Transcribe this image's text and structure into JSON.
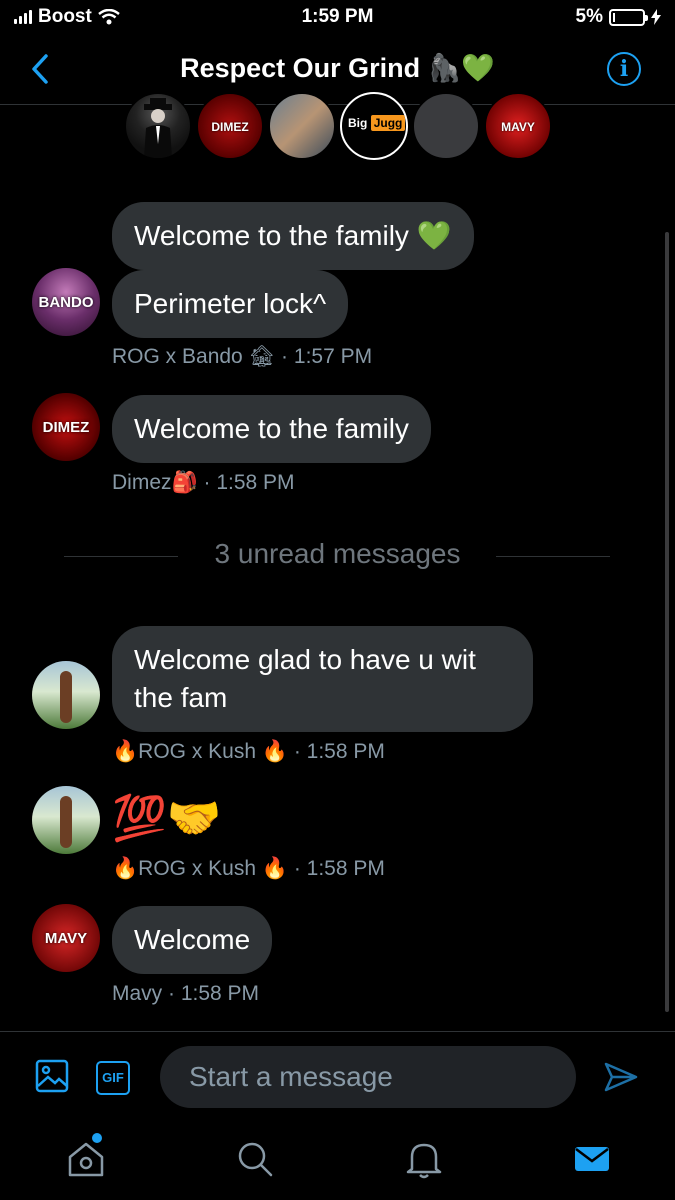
{
  "status_bar": {
    "carrier": "Boost",
    "time": "1:59 PM",
    "battery": "5%"
  },
  "header": {
    "title": "Respect Our Grind 🦍💚"
  },
  "members": {
    "items": [
      {
        "label": ""
      },
      {
        "label": "DIMEZ"
      },
      {
        "label": ""
      },
      {
        "label": "Big",
        "badge": "Jugg"
      },
      {
        "label": ""
      },
      {
        "label": "MAVY"
      }
    ]
  },
  "messages": [
    {
      "text": "Welcome to the family 💚"
    },
    {
      "text": "Perimeter lock^"
    },
    {
      "text": "Welcome to the family"
    },
    {
      "text": "Welcome glad to have u wit the fam"
    },
    {
      "text": "💯🤝"
    },
    {
      "text": "Welcome"
    }
  ],
  "meta": [
    "ROG x Bando 🏚 · 1:57 PM",
    "Dimez🎒 · 1:58 PM",
    "🔥ROG x Kush 🔥 · 1:58 PM",
    "🔥ROG x Kush 🔥 · 1:58 PM",
    "Mavy · 1:58 PM"
  ],
  "avatars": {
    "bando": "BANDO",
    "dimez": "DIMEZ",
    "mavy": "MAVY"
  },
  "unread": "3 unread messages",
  "composer": {
    "gif": "GIF",
    "placeholder": "Start a message"
  },
  "colors": {
    "accent": "#1da1f2",
    "bubble": "#2f3336",
    "meta": "#8899a6"
  }
}
